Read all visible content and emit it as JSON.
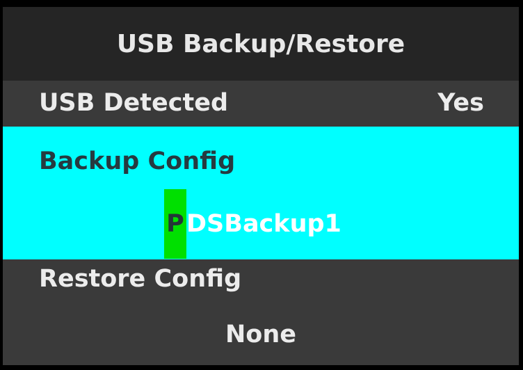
{
  "header": {
    "title": "USB Backup/Restore"
  },
  "menu": {
    "usb_detected": {
      "label": "USB Detected",
      "value": "Yes"
    },
    "backup_config": {
      "label": "Backup Config",
      "filename_cursor_char": "P",
      "filename_rest": "DSBackup1",
      "filename_full": "PDSBackup1"
    },
    "restore_config": {
      "label": "Restore Config",
      "value": "None"
    }
  },
  "colors": {
    "title_bg": "#252525",
    "screen_bg": "#3a3a3a",
    "highlight_bg": "#00ffff",
    "cursor_bg": "#00e000",
    "text_light": "#ececec",
    "text_dark": "#263a40"
  }
}
